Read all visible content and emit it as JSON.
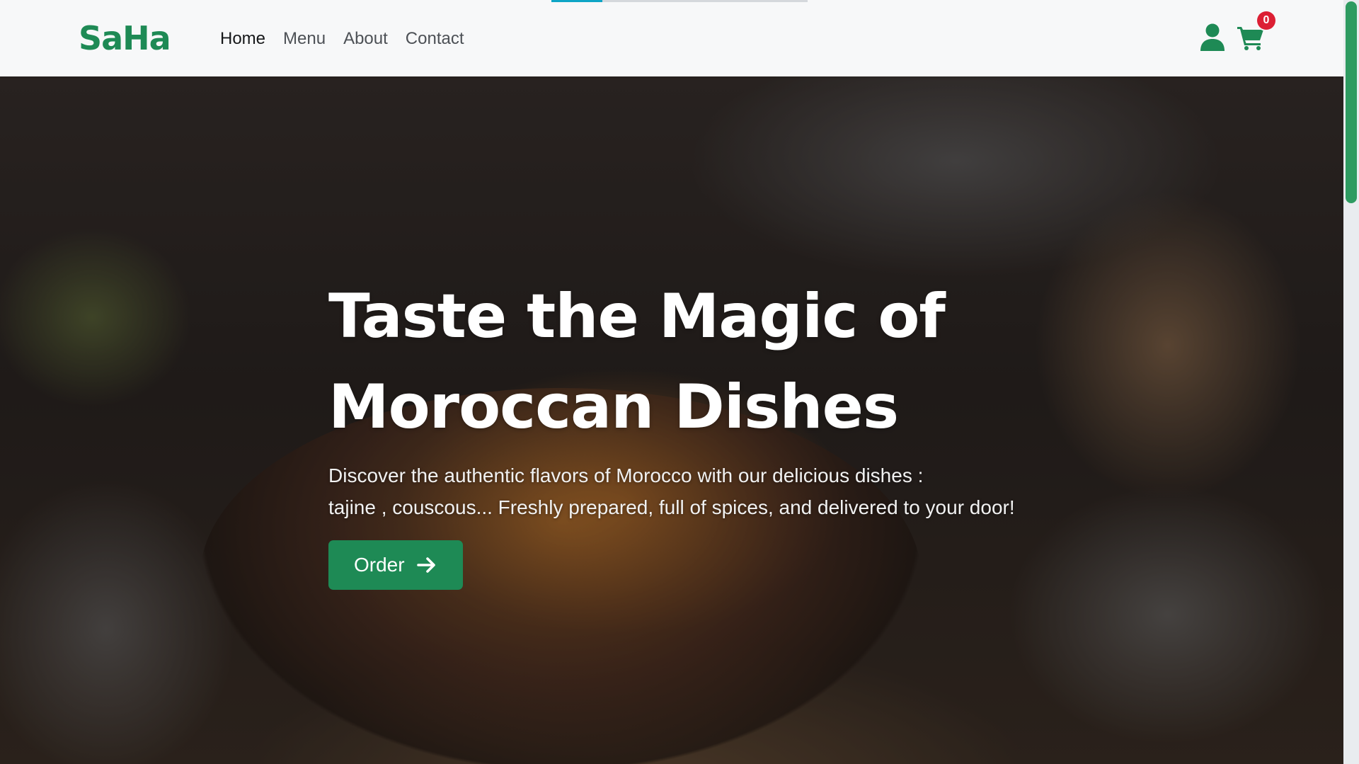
{
  "brand": {
    "name": "SaHa",
    "color": "#1e8a55"
  },
  "loading_bar": {
    "progress": 0.2
  },
  "nav": {
    "items": [
      {
        "label": "Home",
        "active": true
      },
      {
        "label": "Menu",
        "active": false
      },
      {
        "label": "About",
        "active": false
      },
      {
        "label": "Contact",
        "active": false
      }
    ]
  },
  "header_icons": {
    "user_icon": "user-icon",
    "cart_icon": "shopping-cart-icon",
    "cart_count": "0",
    "badge_color": "#dc1f34"
  },
  "hero": {
    "title_line1": "Taste the Magic of",
    "title_line2": "Moroccan Dishes",
    "subtitle_line1": "Discover the authentic flavors of Morocco with our delicious dishes :",
    "subtitle_line2": "tajine , couscous... Freshly prepared, full of spices, and delivered to your door!",
    "cta_label": "Order",
    "cta_icon": "arrow-right-icon",
    "cta_color": "#1e8a55"
  }
}
